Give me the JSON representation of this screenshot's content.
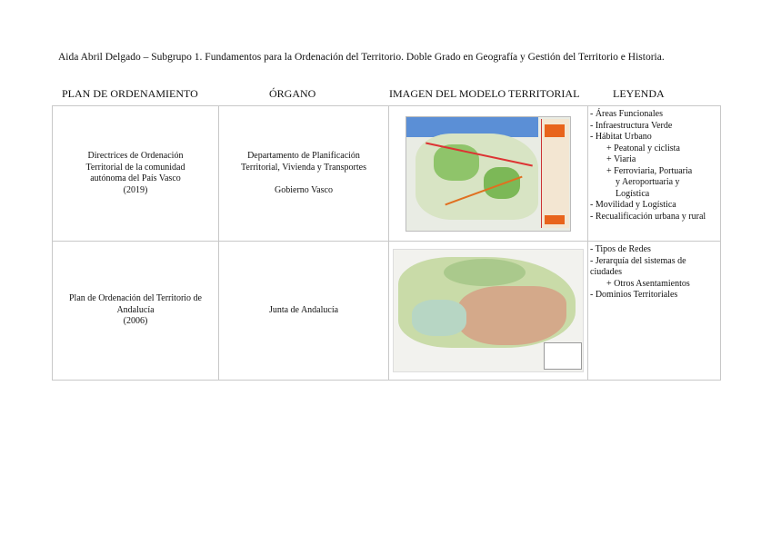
{
  "title": "Aida Abril Delgado – Subgrupo 1. Fundamentos para la Ordenación del Territorio. Doble Grado en Geografía y Gestión del Territorio e Historia.",
  "headers": [
    "PLAN DE ORDENAMIENTO",
    "ÓRGANO",
    "IMAGEN DEL MODELO TERRITORIAL",
    "LEYENDA"
  ],
  "rows": [
    {
      "plan": [
        "Directrices de Ordenación",
        "Territorial de la comunidad",
        "autónoma del País Vasco",
        "(2019)"
      ],
      "organo": [
        "Departamento de Planificación",
        "Territorial, Vivienda y Transportes",
        "",
        "Gobierno Vasco"
      ],
      "legend": [
        {
          "t": "- Áreas Funcionales",
          "l": 0
        },
        {
          "t": "- Infraestructura Verde",
          "l": 0
        },
        {
          "t": "- Hábitat Urbano",
          "l": 0
        },
        {
          "t": "+ Peatonal y ciclista",
          "l": 1
        },
        {
          "t": "+ Viaria",
          "l": 1
        },
        {
          "t": "+ Ferroviaria, Portuaria",
          "l": 1
        },
        {
          "t": "y Aeroportuaria y",
          "l": 2
        },
        {
          "t": "Logística",
          "l": 2
        },
        {
          "t": "- Movilidad y Logística",
          "l": 0
        },
        {
          "t": "- Recualificación urbana y rural",
          "l": 0
        }
      ]
    },
    {
      "plan": [
        "Plan de Ordenación del Territorio de",
        "Andalucía",
        "(2006)"
      ],
      "organo": [
        "Junta de Andalucía"
      ],
      "legend": [
        {
          "t": "- Tipos de Redes",
          "l": 0
        },
        {
          "t": "- Jerarquía del sistemas de ciudades",
          "l": 0
        },
        {
          "t": "+ Otros Asentamientos",
          "l": 1
        },
        {
          "t": "- Dominios Territoriales",
          "l": 0
        }
      ]
    }
  ]
}
